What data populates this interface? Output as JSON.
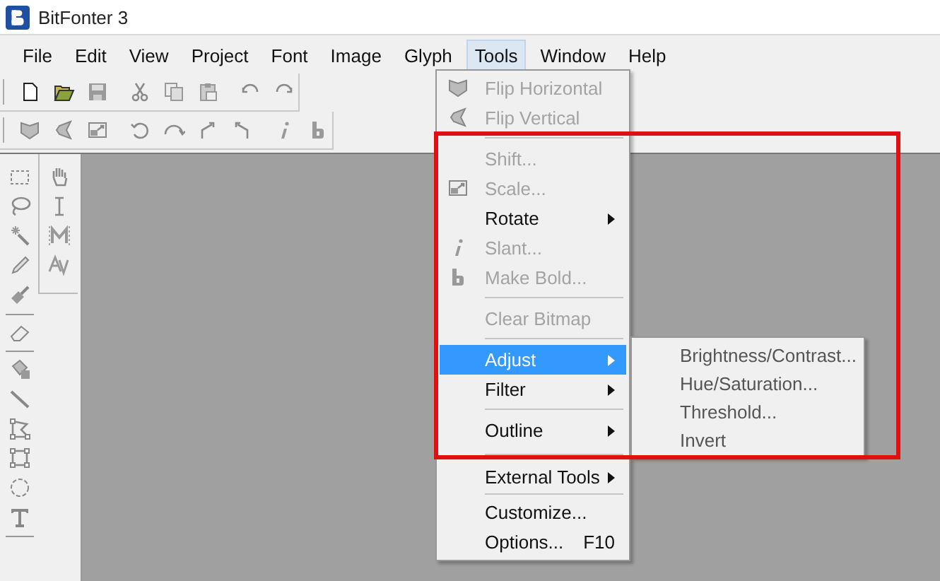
{
  "window": {
    "title": "BitFonter 3"
  },
  "menu_bar": [
    {
      "label": "File",
      "selected": false
    },
    {
      "label": "Edit",
      "selected": false
    },
    {
      "label": "View",
      "selected": false
    },
    {
      "label": "Project",
      "selected": false
    },
    {
      "label": "Font",
      "selected": false
    },
    {
      "label": "Image",
      "selected": false
    },
    {
      "label": "Glyph",
      "selected": false
    },
    {
      "label": "Tools",
      "selected": true
    },
    {
      "label": "Window",
      "selected": false
    },
    {
      "label": "Help",
      "selected": false
    }
  ],
  "tools_menu": [
    {
      "kind": "item",
      "label": "Flip Horizontal",
      "disabled": true,
      "selected": false
    },
    {
      "kind": "item",
      "label": "Flip Vertical",
      "disabled": true,
      "selected": false
    },
    {
      "kind": "separator"
    },
    {
      "kind": "item",
      "label": "Shift...",
      "disabled": true,
      "selected": false
    },
    {
      "kind": "item",
      "label": "Scale...",
      "disabled": true,
      "selected": false
    },
    {
      "kind": "submenu",
      "label": "Rotate",
      "disabled": false,
      "selected": false
    },
    {
      "kind": "item",
      "label": "Slant...",
      "disabled": true,
      "selected": false
    },
    {
      "kind": "item",
      "label": "Make Bold...",
      "disabled": true,
      "selected": false
    },
    {
      "kind": "separator"
    },
    {
      "kind": "item",
      "label": "Clear Bitmap",
      "disabled": true,
      "selected": false
    },
    {
      "kind": "separator"
    },
    {
      "kind": "submenu",
      "label": "Adjust",
      "disabled": false,
      "selected": true
    },
    {
      "kind": "submenu",
      "label": "Filter",
      "disabled": false,
      "selected": false
    },
    {
      "kind": "separator"
    },
    {
      "kind": "submenu",
      "label": "Outline",
      "disabled": false,
      "selected": false
    },
    {
      "kind": "separator"
    },
    {
      "kind": "submenu",
      "label": "External Tools",
      "disabled": false,
      "selected": false
    },
    {
      "kind": "separator"
    },
    {
      "kind": "item",
      "label": "Customize...",
      "disabled": false,
      "selected": false
    },
    {
      "kind": "item",
      "label": "Options...",
      "shortcut": "F10",
      "disabled": false,
      "selected": false
    }
  ],
  "adjust_submenu": [
    {
      "label": "Brightness/Contrast...",
      "disabled": false,
      "selected": false
    },
    {
      "label": "Hue/Saturation...",
      "disabled": false,
      "selected": false
    },
    {
      "label": "Threshold...",
      "disabled": false,
      "selected": false
    },
    {
      "label": "Invert",
      "disabled": false,
      "selected": false
    }
  ]
}
